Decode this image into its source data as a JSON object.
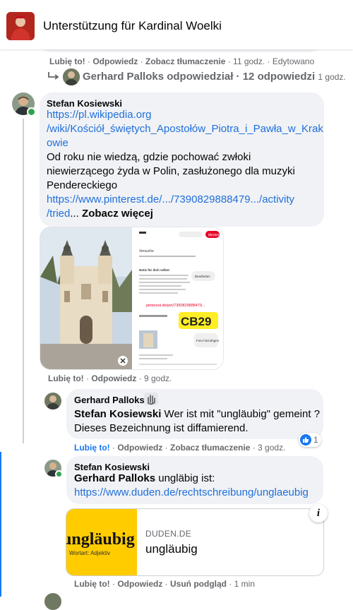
{
  "header": {
    "title": "Unterstützung für Kardinal Woelki"
  },
  "top_actions": {
    "like": "Lubię to!",
    "reply": "Odpowiedz",
    "translate": "Zobacz tłumaczenie",
    "time": "11 godz.",
    "edited": "Edytowano"
  },
  "reply_summary": {
    "text": "Gerhard Palloks odpowiedział · 12 odpowiedzi",
    "time": "1 godz."
  },
  "comment1": {
    "author": "Stefan Kosiewski",
    "link1_line1": "https://pl.wikipedia.org",
    "link1_line2": "/wiki/Kościół_świętych_Apostołów_Piotra_i_Pawła_w_Krak",
    "link1_line3": "owie",
    "text_line1": "Od roku nie wiedzą, gdzie pochować zwłoki",
    "text_line2": "niewierzącego żyda w Polin, zasłużonego dla muzyki",
    "text_line3": "Pendereckiego",
    "link2_line1": "https://www.pinterest.de/.../7390829888479.../activity",
    "link2_line2": "/tried",
    "see_more": "Zobacz więcej",
    "attachment": {
      "badge": "CB29",
      "pin_link": "pinterest.de/pin/7390829888479...",
      "panel_title": "Versuche",
      "panel_button": "Bearbeiten",
      "panel_heading": "Notiz für dich selbst",
      "photo_label": "Foto hinzufügen",
      "save_button": "Merken"
    },
    "actions": {
      "like": "Lubię to!",
      "reply": "Odpowiedz",
      "time": "9 godz."
    }
  },
  "comment2": {
    "author": "Gerhard Palloks",
    "mention": "Stefan Kosiewski",
    "text_line1": " Wer ist mit \"ungläubig\" gemeint ?",
    "text_line2": "Dieses Bezeichnung ist diffamierend.",
    "reaction_count": "1",
    "actions": {
      "like": "Lubię to!",
      "reply": "Odpowiedz",
      "translate": "Zobacz tłumaczenie",
      "time": "3 godz."
    }
  },
  "comment3": {
    "author": "Stefan Kosiewski",
    "mention": "Gerhard Palloks",
    "text": " ungläbig ist:",
    "link": "https://www.duden.de/rechtschreibung/unglaeubig",
    "preview": {
      "image_word": "ungläubig",
      "image_sub": "Wortart: Adjektiv",
      "domain": "DUDEN.DE",
      "title": "ungläubig"
    },
    "actions": {
      "like": "Lubię to!",
      "reply": "Odpowiedz",
      "remove_preview": "Usuń podgląd",
      "time": "1 min"
    }
  },
  "colors": {
    "link": "#216fdb",
    "bubble": "#f0f2f5",
    "online": "#31a24c",
    "duden_yellow": "#ffcc00",
    "thread": "#1877f2"
  }
}
